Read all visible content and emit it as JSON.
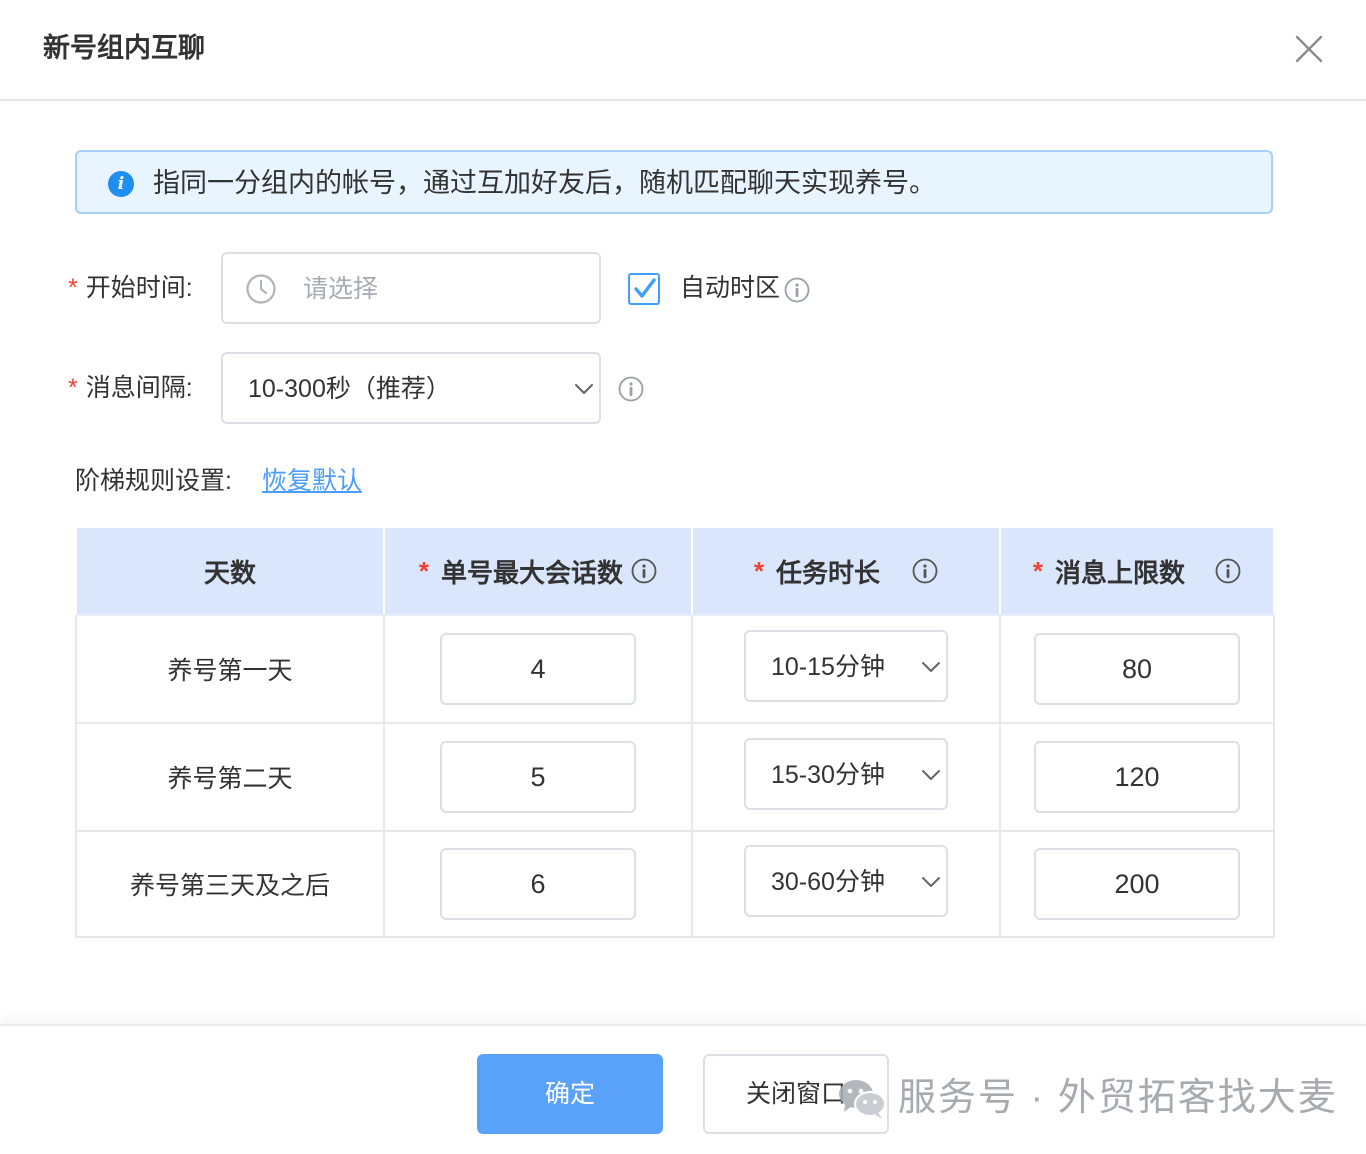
{
  "dialog": {
    "title": "新号组内互聊"
  },
  "alert": {
    "text": "指同一分组内的帐号，通过互加好友后，随机匹配聊天实现养号。"
  },
  "form": {
    "start_time": {
      "label": "开始时间:",
      "placeholder": "请选择"
    },
    "auto_timezone": {
      "label": "自动时区",
      "checked": true
    },
    "interval": {
      "label": "消息间隔:",
      "value": "10-300秒（推荐）"
    }
  },
  "ladder": {
    "label": "阶梯规则设置:",
    "restore_link": "恢复默认"
  },
  "table": {
    "headers": [
      {
        "label": "天数",
        "required": false
      },
      {
        "label": "单号最大会话数",
        "required": true
      },
      {
        "label": "任务时长",
        "required": true
      },
      {
        "label": "消息上限数",
        "required": true
      }
    ],
    "rows": [
      {
        "day": "养号第一天",
        "max_sessions": "4",
        "duration": "10-15分钟",
        "msg_limit": "80"
      },
      {
        "day": "养号第二天",
        "max_sessions": "5",
        "duration": "15-30分钟",
        "msg_limit": "120"
      },
      {
        "day": "养号第三天及之后",
        "max_sessions": "6",
        "duration": "30-60分钟",
        "msg_limit": "200"
      }
    ]
  },
  "footer": {
    "confirm_label": "确定",
    "close_label": "关闭窗口"
  },
  "watermark": {
    "text": "服务号 · 外贸拓客找大麦"
  },
  "icons": {
    "close": "close-icon",
    "info": "info-icon",
    "clock": "clock-icon",
    "checkbox": "checkmark-icon",
    "dropdown": "chevron-down-icon",
    "watermark": "wechat-icon"
  },
  "colors": {
    "accent": "#409eff",
    "primary_button": "#5aa2f9",
    "link": "#4a9df8",
    "required": "#f04134",
    "table_header_bg": "#d9e6fb",
    "alert_bg": "#e8f4ff"
  }
}
